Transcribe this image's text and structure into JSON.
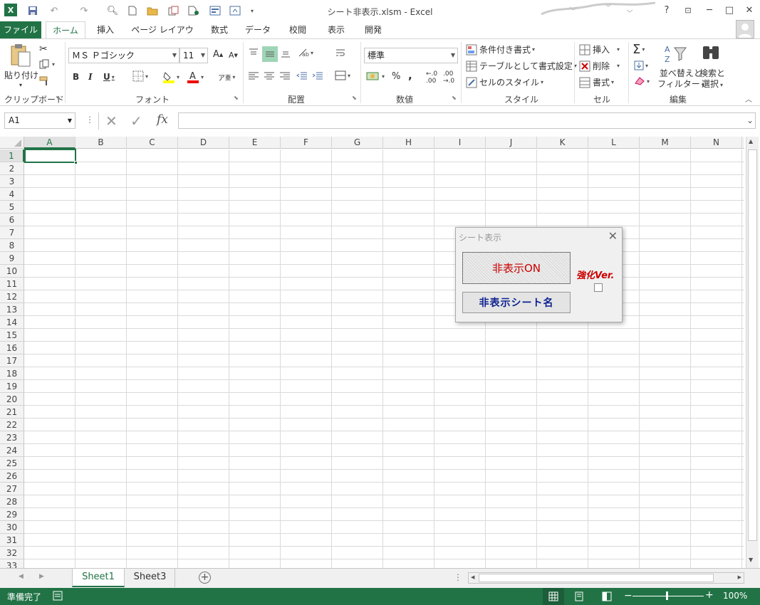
{
  "window": {
    "title": "シート非表示.xlsm - Excel",
    "help": "?"
  },
  "tabs": [
    "ファイル",
    "ホーム",
    "挿入",
    "ページ レイアウト",
    "数式",
    "データ",
    "校閲",
    "表示",
    "開発"
  ],
  "clipboard": {
    "paste": "貼り付け",
    "group": "クリップボード"
  },
  "font": {
    "name": "ＭＳ Ｐゴシック",
    "size": "11",
    "bold": "B",
    "italic": "I",
    "underline": "U",
    "group": "フォント"
  },
  "alignment": {
    "group": "配置"
  },
  "number": {
    "format": "標準",
    "percent": "%",
    "comma": ",",
    "group": "数値"
  },
  "styles": {
    "conditional": "条件付き書式",
    "table": "テーブルとして書式設定",
    "cell": "セルのスタイル",
    "group": "スタイル"
  },
  "cells": {
    "insert": "挿入",
    "delete": "削除",
    "format": "書式",
    "group": "セル"
  },
  "editing": {
    "sort1": "並べ替えと",
    "sort2": "フィルター",
    "find1": "検索と",
    "find2": "選択",
    "group": "編集"
  },
  "formula_bar": {
    "name_box": "A1",
    "fx": "fx"
  },
  "columns": [
    "A",
    "B",
    "C",
    "D",
    "E",
    "F",
    "G",
    "H",
    "I",
    "J",
    "K",
    "L",
    "M",
    "N"
  ],
  "rows": [
    "1",
    "2",
    "3",
    "4",
    "5",
    "6",
    "7",
    "8",
    "9",
    "10",
    "11",
    "12",
    "13",
    "14",
    "15",
    "16",
    "17",
    "18",
    "19",
    "20",
    "21",
    "22",
    "23",
    "24",
    "25",
    "26",
    "27",
    "28",
    "29",
    "30",
    "31",
    "32",
    "33"
  ],
  "sheets": [
    "Sheet1",
    "Sheet3"
  ],
  "status": {
    "ready": "準備完了",
    "zoom": "100%"
  },
  "dialog": {
    "title": "シート表示",
    "hide_on": "非表示ON",
    "hidden_names": "非表示シート名",
    "enhanced": "強化Ver."
  },
  "colors": {
    "accent": "#217346",
    "dialog_red": "#cc0000",
    "dialog_blue": "#0a1f8f"
  }
}
